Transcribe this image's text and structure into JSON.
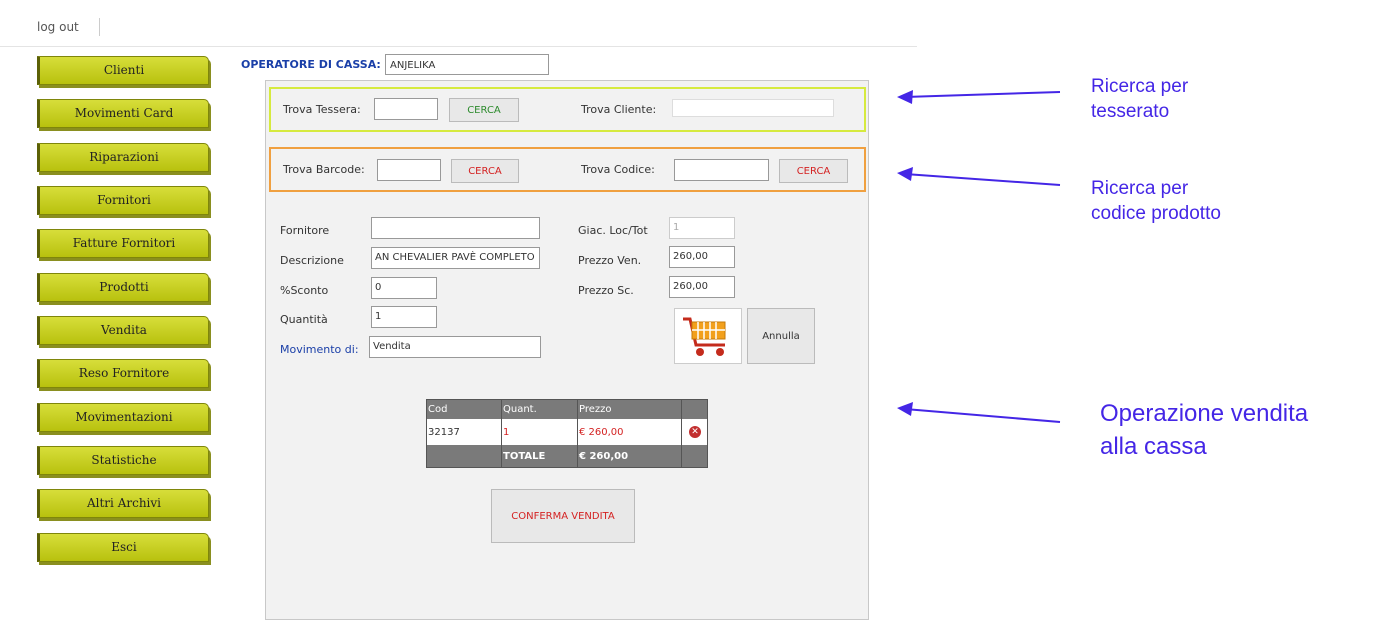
{
  "topbar": {
    "logout_label": "log out"
  },
  "sidebar": {
    "items": [
      {
        "label": "Clienti"
      },
      {
        "label": "Movimenti Card"
      },
      {
        "label": "Riparazioni"
      },
      {
        "label": "Fornitori"
      },
      {
        "label": "Fatture Fornitori"
      },
      {
        "label": "Prodotti"
      },
      {
        "label": "Vendita"
      },
      {
        "label": "Reso Fornitore"
      },
      {
        "label": "Movimentazioni"
      },
      {
        "label": "Statistiche"
      },
      {
        "label": "Altri Archivi"
      },
      {
        "label": "Esci"
      }
    ]
  },
  "operator": {
    "label": "OPERATORE DI CASSA:",
    "value": "ANJELIKA"
  },
  "search_card": {
    "tessera_label": "Trova Tessera:",
    "tessera_value": "",
    "cerca_label": "CERCA",
    "cliente_label": "Trova Cliente:",
    "cliente_value": ""
  },
  "search_product": {
    "barcode_label": "Trova Barcode:",
    "barcode_value": "",
    "cerca_barcode_label": "CERCA",
    "codice_label": "Trova Codice:",
    "codice_value": "",
    "cerca_codice_label": "CERCA"
  },
  "product_form": {
    "fornitore_label": "Fornitore",
    "fornitore_value": "",
    "descrizione_label": "Descrizione",
    "descrizione_value": "AN CHEVALIER PAVÈ COMPLETO",
    "sconto_label": "%Sconto",
    "sconto_value": "0",
    "quantita_label": "Quantità",
    "quantita_value": "1",
    "movimento_label": "Movimento di:",
    "movimento_value": "Vendita",
    "giacenza_label": "Giac. Loc/Tot",
    "giacenza_value": "1",
    "prezzo_ven_label": "Prezzo Ven.",
    "prezzo_ven_value": "260,00",
    "prezzo_sc_label": "Prezzo Sc.",
    "prezzo_sc_value": "260,00",
    "annulla_label": "Annulla"
  },
  "sale_table": {
    "headers": [
      "Cod",
      "Quant.",
      "Prezzo"
    ],
    "rows": [
      {
        "cod": "32137",
        "quant": "1",
        "prezzo": "€ 260,00"
      }
    ],
    "total_label": "TOTALE",
    "total_value": "€ 260,00"
  },
  "confirm_label": "CONFERMA VENDITA",
  "annotations": {
    "search_card": [
      "Ricerca per",
      "tesserato"
    ],
    "search_product": [
      "Ricerca per",
      "codice prodotto"
    ],
    "sale": [
      "Operazione vendita",
      "alla cassa"
    ]
  },
  "colors": {
    "menu_button": "#c9d11f",
    "yellow_border": "#d6ea3e",
    "orange_border": "#f0a040",
    "operator_label": "#1a3fa8",
    "annotation": "#4426e6",
    "cerca_green": "#2d8b2d",
    "cerca_red": "#d42222"
  }
}
